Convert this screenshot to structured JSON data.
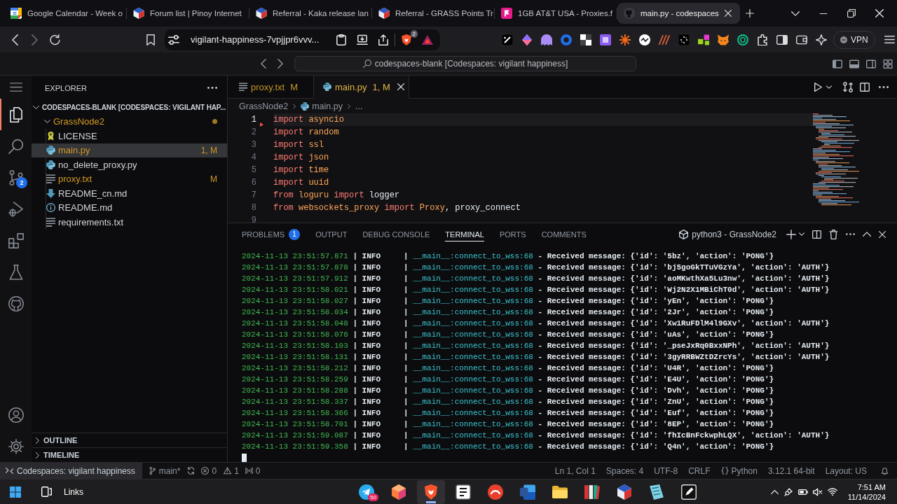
{
  "browser": {
    "tabs": [
      {
        "title": "Google Calendar - Week o",
        "kind": "calendar",
        "selected": false
      },
      {
        "title": "Forum list | Pinoy Internet",
        "kind": "cube",
        "selected": false
      },
      {
        "title": "Referral - Kaka release lan",
        "kind": "cube",
        "selected": false
      },
      {
        "title": "Referral - GRASS Points Tr",
        "kind": "cube",
        "selected": false
      },
      {
        "title": "1GB AT&T USA - Proxies.f",
        "kind": "flag",
        "selected": false
      },
      {
        "title": "main.py - codespaces",
        "kind": "github",
        "selected": true
      }
    ],
    "address": "vigilant-happiness-7vpjjpr6vvv...",
    "shield_badge": "2",
    "vpn_label": "VPN"
  },
  "title_bar": {
    "command_center": "codespaces-blank [Codespaces: vigilant happiness]"
  },
  "activity_bar": [
    {
      "kind": "explorer",
      "selected": true
    },
    {
      "kind": "search",
      "selected": false
    },
    {
      "kind": "source_control",
      "selected": false,
      "badge": "2"
    },
    {
      "kind": "run_debug",
      "selected": false
    },
    {
      "kind": "extensions",
      "selected": false
    },
    {
      "kind": "testing",
      "selected": false
    },
    {
      "kind": "github",
      "selected": false
    }
  ],
  "explorer": {
    "title": "EXPLORER",
    "root": {
      "label": "CODESPACES-BLANK [CODESPACES: VIGILANT HAP...",
      "expanded": true
    },
    "tree": [
      {
        "name": "GrassNode2",
        "expanded": true,
        "selected": false,
        "modified": true,
        "children": [
          {
            "name": "LICENSE",
            "kind": "license",
            "selected": false,
            "modified": false
          },
          {
            "name": "main.py",
            "kind": "python",
            "selected": true,
            "modified": true,
            "badge": "1, M"
          },
          {
            "name": "no_delete_proxy.py",
            "kind": "python",
            "selected": false,
            "modified": false
          },
          {
            "name": "proxy.txt",
            "kind": "text",
            "selected": false,
            "modified": true,
            "badge": "M"
          },
          {
            "name": "README_cn.md",
            "kind": "markdown",
            "selected": false,
            "modified": false
          },
          {
            "name": "README.md",
            "kind": "info",
            "selected": false,
            "modified": false
          },
          {
            "name": "requirements.txt",
            "kind": "text",
            "selected": false,
            "modified": false
          }
        ]
      }
    ],
    "sections": [
      {
        "label": "OUTLINE",
        "expanded": false
      },
      {
        "label": "TIMELINE",
        "expanded": false
      }
    ]
  },
  "editor": {
    "tabs": [
      {
        "label": "proxy.txt",
        "kind": "text",
        "badge": "M",
        "selected": false,
        "modified": true
      },
      {
        "label": "main.py",
        "kind": "python",
        "badge": "1, M",
        "selected": true,
        "modified": true
      }
    ],
    "breadcrumbs": [
      {
        "label": "GrassNode2",
        "kind": "folder"
      },
      {
        "label": "main.py",
        "kind": "python"
      },
      {
        "label": "...",
        "kind": "more"
      }
    ],
    "lines": [
      {
        "number": "1",
        "current": true,
        "tokens": [
          {
            "text": "import",
            "kind": "keyword"
          },
          {
            "text": " asyncio",
            "kind": "module"
          }
        ]
      },
      {
        "number": "2",
        "current": false,
        "tokens": [
          {
            "text": "import",
            "kind": "keyword"
          },
          {
            "text": " random",
            "kind": "module"
          }
        ]
      },
      {
        "number": "3",
        "current": false,
        "tokens": [
          {
            "text": "import",
            "kind": "keyword"
          },
          {
            "text": " ssl",
            "kind": "module"
          }
        ]
      },
      {
        "number": "4",
        "current": false,
        "tokens": [
          {
            "text": "import",
            "kind": "keyword"
          },
          {
            "text": " json",
            "kind": "module"
          }
        ]
      },
      {
        "number": "5",
        "current": false,
        "tokens": [
          {
            "text": "import",
            "kind": "keyword"
          },
          {
            "text": " time",
            "kind": "module"
          }
        ]
      },
      {
        "number": "6",
        "current": false,
        "tokens": [
          {
            "text": "import",
            "kind": "keyword"
          },
          {
            "text": " uuid",
            "kind": "module"
          }
        ]
      },
      {
        "number": "7",
        "current": false,
        "tokens": [
          {
            "text": "from",
            "kind": "keyword"
          },
          {
            "text": " loguru",
            "kind": "module"
          },
          {
            "text": " import",
            "kind": "keyword"
          },
          {
            "text": " logger",
            "kind": "name"
          }
        ]
      },
      {
        "number": "8",
        "current": false,
        "tokens": [
          {
            "text": "from",
            "kind": "keyword"
          },
          {
            "text": " websockets_proxy",
            "kind": "module"
          },
          {
            "text": " import",
            "kind": "keyword"
          },
          {
            "text": " Proxy",
            "kind": "class"
          },
          {
            "text": ",",
            "kind": "punct"
          },
          {
            "text": " proxy_connect",
            "kind": "name"
          }
        ]
      },
      {
        "number": "9",
        "current": false
      }
    ]
  },
  "panel": {
    "tabs": [
      {
        "label": "PROBLEMS",
        "selected": false,
        "badge": "1"
      },
      {
        "label": "OUTPUT",
        "selected": false
      },
      {
        "label": "DEBUG CONSOLE",
        "selected": false
      },
      {
        "label": "TERMINAL",
        "selected": true
      },
      {
        "label": "PORTS",
        "selected": false
      },
      {
        "label": "COMMENTS",
        "selected": false
      }
    ],
    "terminal": {
      "name": "python3 - GrassNode2",
      "lines": [
        {
          "time": "2024-11-13 23:51:57.871",
          "level": "| INFO     |",
          "source": "__main__:connect_to_wss:68",
          "message": "- Received message: {'id': '5bz', 'action': 'PONG'}"
        },
        {
          "time": "2024-11-13 23:51:57.878",
          "level": "| INFO     |",
          "source": "__main__:connect_to_wss:68",
          "message": "- Received message: {'id': 'bj5goGkTTuVGzYa', 'action': 'AUTH'}"
        },
        {
          "time": "2024-11-13 23:51:57.912",
          "level": "| INFO     |",
          "source": "__main__:connect_to_wss:68",
          "message": "- Received message: {'id': 'aoMKwthXa5Lu3nw', 'action': 'AUTH'}"
        },
        {
          "time": "2024-11-13 23:51:58.021",
          "level": "| INFO     |",
          "source": "__main__:connect_to_wss:68",
          "message": "- Received message: {'id': 'Wj2N2X1MBiChT0d', 'action': 'AUTH'}"
        },
        {
          "time": "2024-11-13 23:51:58.027",
          "level": "| INFO     |",
          "source": "__main__:connect_to_wss:68",
          "message": "- Received message: {'id': 'yEn', 'action': 'PONG'}"
        },
        {
          "time": "2024-11-13 23:51:58.034",
          "level": "| INFO     |",
          "source": "__main__:connect_to_wss:68",
          "message": "- Received message: {'id': '2Jr', 'action': 'PONG'}"
        },
        {
          "time": "2024-11-13 23:51:58.048",
          "level": "| INFO     |",
          "source": "__main__:connect_to_wss:68",
          "message": "- Received message: {'id': 'Xw1RuFDlM4l9GXv', 'action': 'AUTH'}"
        },
        {
          "time": "2024-11-13 23:51:58.076",
          "level": "| INFO     |",
          "source": "__main__:connect_to_wss:68",
          "message": "- Received message: {'id': 'uAs', 'action': 'PONG'}"
        },
        {
          "time": "2024-11-13 23:51:58.103",
          "level": "| INFO     |",
          "source": "__main__:connect_to_wss:68",
          "message": "- Received message: {'id': '_pseJxRq0BxxNPh', 'action': 'AUTH'}"
        },
        {
          "time": "2024-11-13 23:51:58.131",
          "level": "| INFO     |",
          "source": "__main__:connect_to_wss:68",
          "message": "- Received message: {'id': '3gyRRBWZtDZrcYs', 'action': 'AUTH'}"
        },
        {
          "time": "2024-11-13 23:51:58.212",
          "level": "| INFO     |",
          "source": "__main__:connect_to_wss:68",
          "message": "- Received message: {'id': 'U4R', 'action': 'PONG'}"
        },
        {
          "time": "2024-11-13 23:51:58.259",
          "level": "| INFO     |",
          "source": "__main__:connect_to_wss:68",
          "message": "- Received message: {'id': 'E4U', 'action': 'PONG'}"
        },
        {
          "time": "2024-11-13 23:51:58.288",
          "level": "| INFO     |",
          "source": "__main__:connect_to_wss:68",
          "message": "- Received message: {'id': 'Dvh', 'action': 'PONG'}"
        },
        {
          "time": "2024-11-13 23:51:58.337",
          "level": "| INFO     |",
          "source": "__main__:connect_to_wss:68",
          "message": "- Received message: {'id': 'ZnU', 'action': 'PONG'}"
        },
        {
          "time": "2024-11-13 23:51:58.366",
          "level": "| INFO     |",
          "source": "__main__:connect_to_wss:68",
          "message": "- Received message: {'id': 'Euf', 'action': 'PONG'}"
        },
        {
          "time": "2024-11-13 23:51:58.701",
          "level": "| INFO     |",
          "source": "__main__:connect_to_wss:68",
          "message": "- Received message: {'id': '8EP', 'action': 'PONG'}"
        },
        {
          "time": "2024-11-13 23:51:59.087",
          "level": "| INFO     |",
          "source": "__main__:connect_to_wss:68",
          "message": "- Received message: {'id': 'fhIcBnFckwphLQX', 'action': 'AUTH'}"
        },
        {
          "time": "2024-11-13 23:51:59.358",
          "level": "| INFO     |",
          "source": "__main__:connect_to_wss:68",
          "message": "- Received message: {'id': 'Q4n', 'action': 'PONG'}"
        }
      ]
    }
  },
  "status_bar": {
    "remote": "Codespaces: vigilant happiness",
    "branch": "main*",
    "errors": "0",
    "warnings": "1",
    "ports": "0",
    "cursor": "Ln 1, Col 1",
    "indent": "Spaces: 4",
    "encoding": "UTF-8",
    "eol": "CRLF",
    "language": "Python",
    "interpreter": "3.12.1 64-bit",
    "keyboard": "Layout: US"
  },
  "taskbar": {
    "toolbar": "Links",
    "apps": [
      {
        "kind": "telegram",
        "selected": false,
        "badge": "50"
      },
      {
        "kind": "cube",
        "selected": false
      },
      {
        "kind": "brave",
        "selected": true
      },
      {
        "kind": "notion",
        "selected": false
      },
      {
        "kind": "wps",
        "selected": false
      },
      {
        "kind": "word",
        "selected": false
      },
      {
        "kind": "files",
        "selected": false
      },
      {
        "kind": "books",
        "selected": false
      },
      {
        "kind": "vpn",
        "selected": false
      },
      {
        "kind": "notes",
        "selected": false
      },
      {
        "kind": "pen",
        "selected": false
      }
    ],
    "time": "7:51 AM",
    "date": "11/14/2024"
  }
}
